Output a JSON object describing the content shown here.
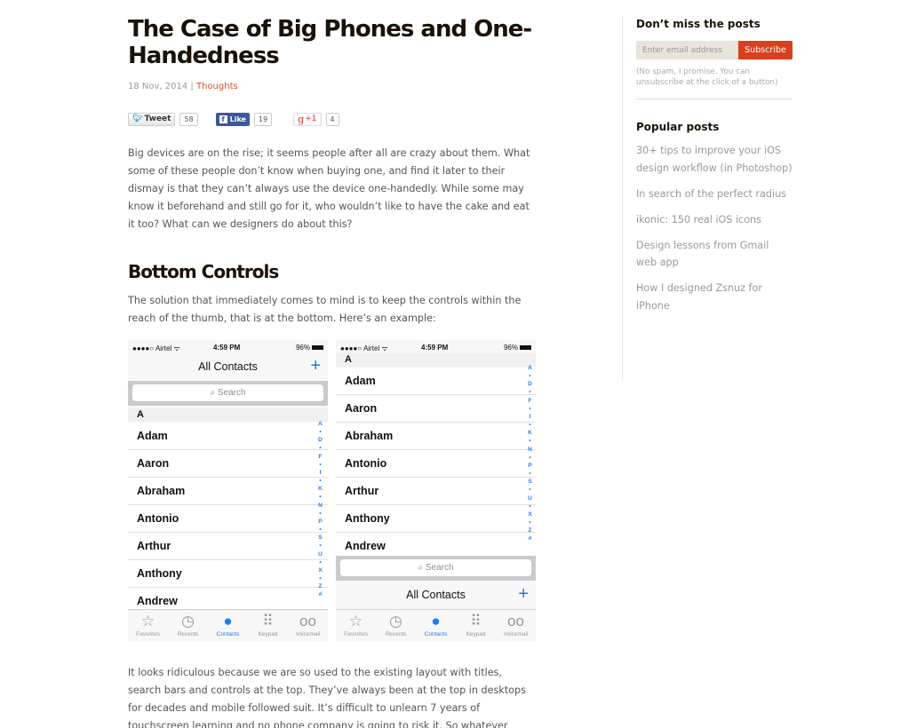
{
  "article": {
    "title": "The Case of Big Phones and One-Handedness",
    "date": "18 Nov, 2014",
    "separator": "|",
    "category": "Thoughts",
    "share": {
      "tweet_label": "Tweet",
      "tweet_count": "58",
      "like_label": "Like",
      "like_count": "19",
      "gplus_label": "+1",
      "gplus_count": "4"
    },
    "intro": "Big devices are on the rise; it seems people after all are crazy about them. What some of these people don’t know when buying one, and find it later to their dismay is that they can’t always use the device one-handedly. While some may know it beforehand and still go for it, who wouldn’t like to have the cake and eat it too? What can we designers do about this?",
    "section_heading": "Bottom Controls",
    "section_para": "The solution that immediately comes to mind is to keep the controls within the reach of the thumb, that is at the bottom. Here’s an example:",
    "after_para": "It looks ridiculous because we are so used to the existing layout with titles, search bars and controls at the top. They’ve always been at the top in desktops for decades and mobile followed suit. It’s difficult to unlearn 7 years of touchscreen learning and no phone company is going to risk it. So whatever"
  },
  "phone_mock": {
    "status": {
      "carrier": "●●●●○ Airtel ᯤ",
      "time": "4:59 PM",
      "battery": "96%"
    },
    "nav_title": "All Contacts",
    "add_icon": "+",
    "search_placeholder": "⌕ Search",
    "section_letter": "A",
    "contacts_left": [
      "Adam",
      "Aaron",
      "Abraham",
      "Antonio",
      "Arthur",
      "Anthony",
      "Andrew"
    ],
    "contacts_right": [
      "Adam",
      "Aaron",
      "Abraham",
      "Antonio",
      "Arthur",
      "Anthony",
      "Andrew"
    ],
    "index_letters": [
      "A",
      "•",
      "D",
      "•",
      "F",
      "•",
      "I",
      "•",
      "K",
      "•",
      "N",
      "•",
      "P",
      "•",
      "S",
      "•",
      "U",
      "•",
      "X",
      "•",
      "Z",
      "#"
    ],
    "tabs": [
      {
        "label": "Favorites",
        "icon": "☆",
        "active": false
      },
      {
        "label": "Recents",
        "icon": "◷",
        "active": false
      },
      {
        "label": "Contacts",
        "icon": "●",
        "active": true
      },
      {
        "label": "Keypad",
        "icon": "⠿",
        "active": false
      },
      {
        "label": "Voicemail",
        "icon": "oo",
        "active": false
      }
    ]
  },
  "sidebar": {
    "newsletter_heading": "Don’t miss the posts",
    "email_placeholder": "Enter email address",
    "subscribe_label": "Subscribe",
    "note": "(No spam, I promise. You can unsubscribe at the click of a button)",
    "popular_heading": "Popular posts",
    "popular_posts": [
      "30+ tips to improve your iOS design workflow (in Photoshop)",
      "In search of the perfect radius",
      "ikonic: 150 real iOS icons",
      "Design lessons from Gmail web app",
      "How I designed Zsnuz for iPhone"
    ]
  },
  "colors": {
    "accent": "#d8401f",
    "ios_blue": "#1a7cf3",
    "facebook": "#3b5998"
  }
}
